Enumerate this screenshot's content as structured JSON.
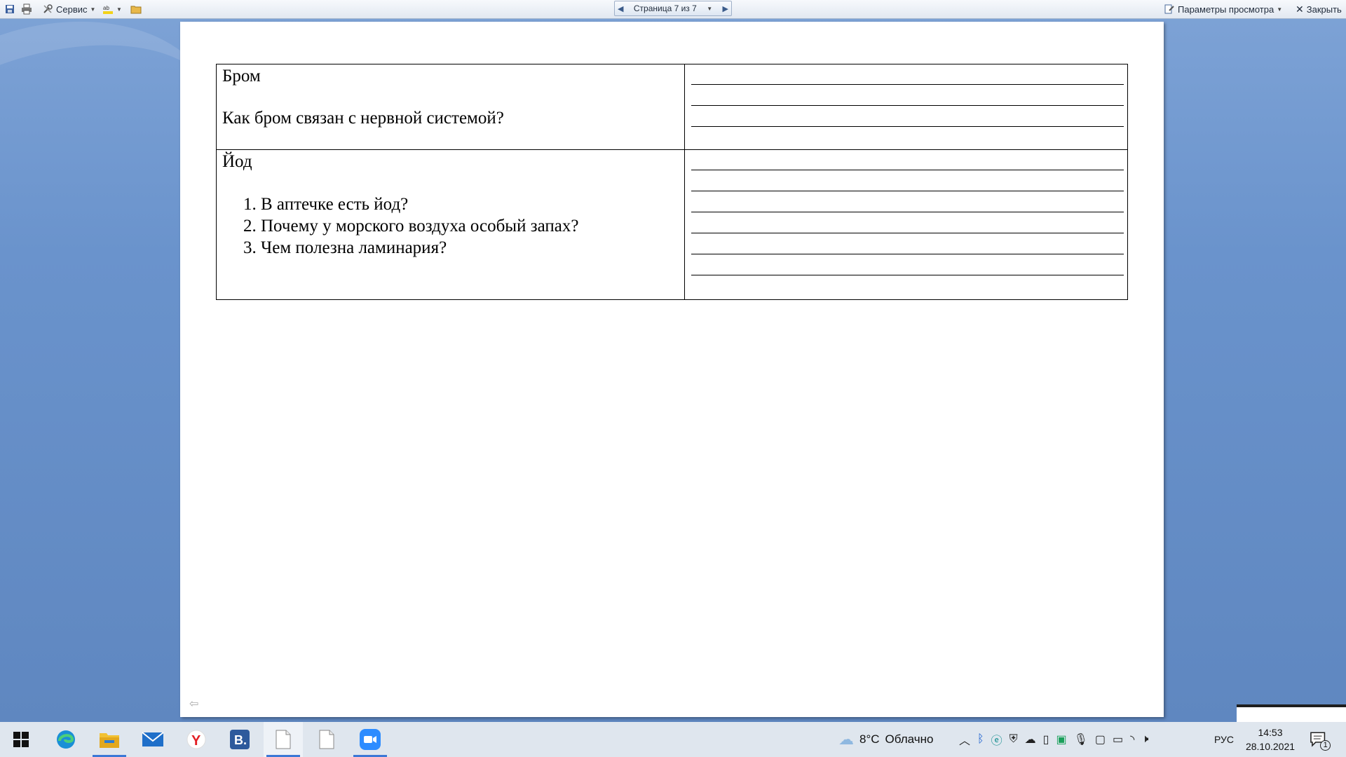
{
  "toolbar": {
    "service_label": "Сервис",
    "page_indicator": "Страница 7 из 7",
    "view_options_label": "Параметры просмотра",
    "close_label": "Закрыть"
  },
  "document": {
    "rows": [
      {
        "title": "Бром",
        "question": "Как бром связан с нервной системой?",
        "answer_lines": 3
      },
      {
        "title": "Йод",
        "questions": [
          "В аптечке есть йод?",
          "Почему у морского воздуха особый запах?",
          "Чем полезна ламинария?"
        ],
        "answer_lines": 6
      }
    ]
  },
  "taskbar": {
    "apps": [
      "start",
      "edge",
      "file-explorer",
      "mail",
      "yandex-browser",
      "vk-b",
      "document-1",
      "document-2",
      "zoom"
    ],
    "weather_temp": "8°C",
    "weather_text": "Облачно",
    "language": "РУС",
    "time": "14:53",
    "date": "28.10.2021",
    "notifications_count": "1"
  }
}
